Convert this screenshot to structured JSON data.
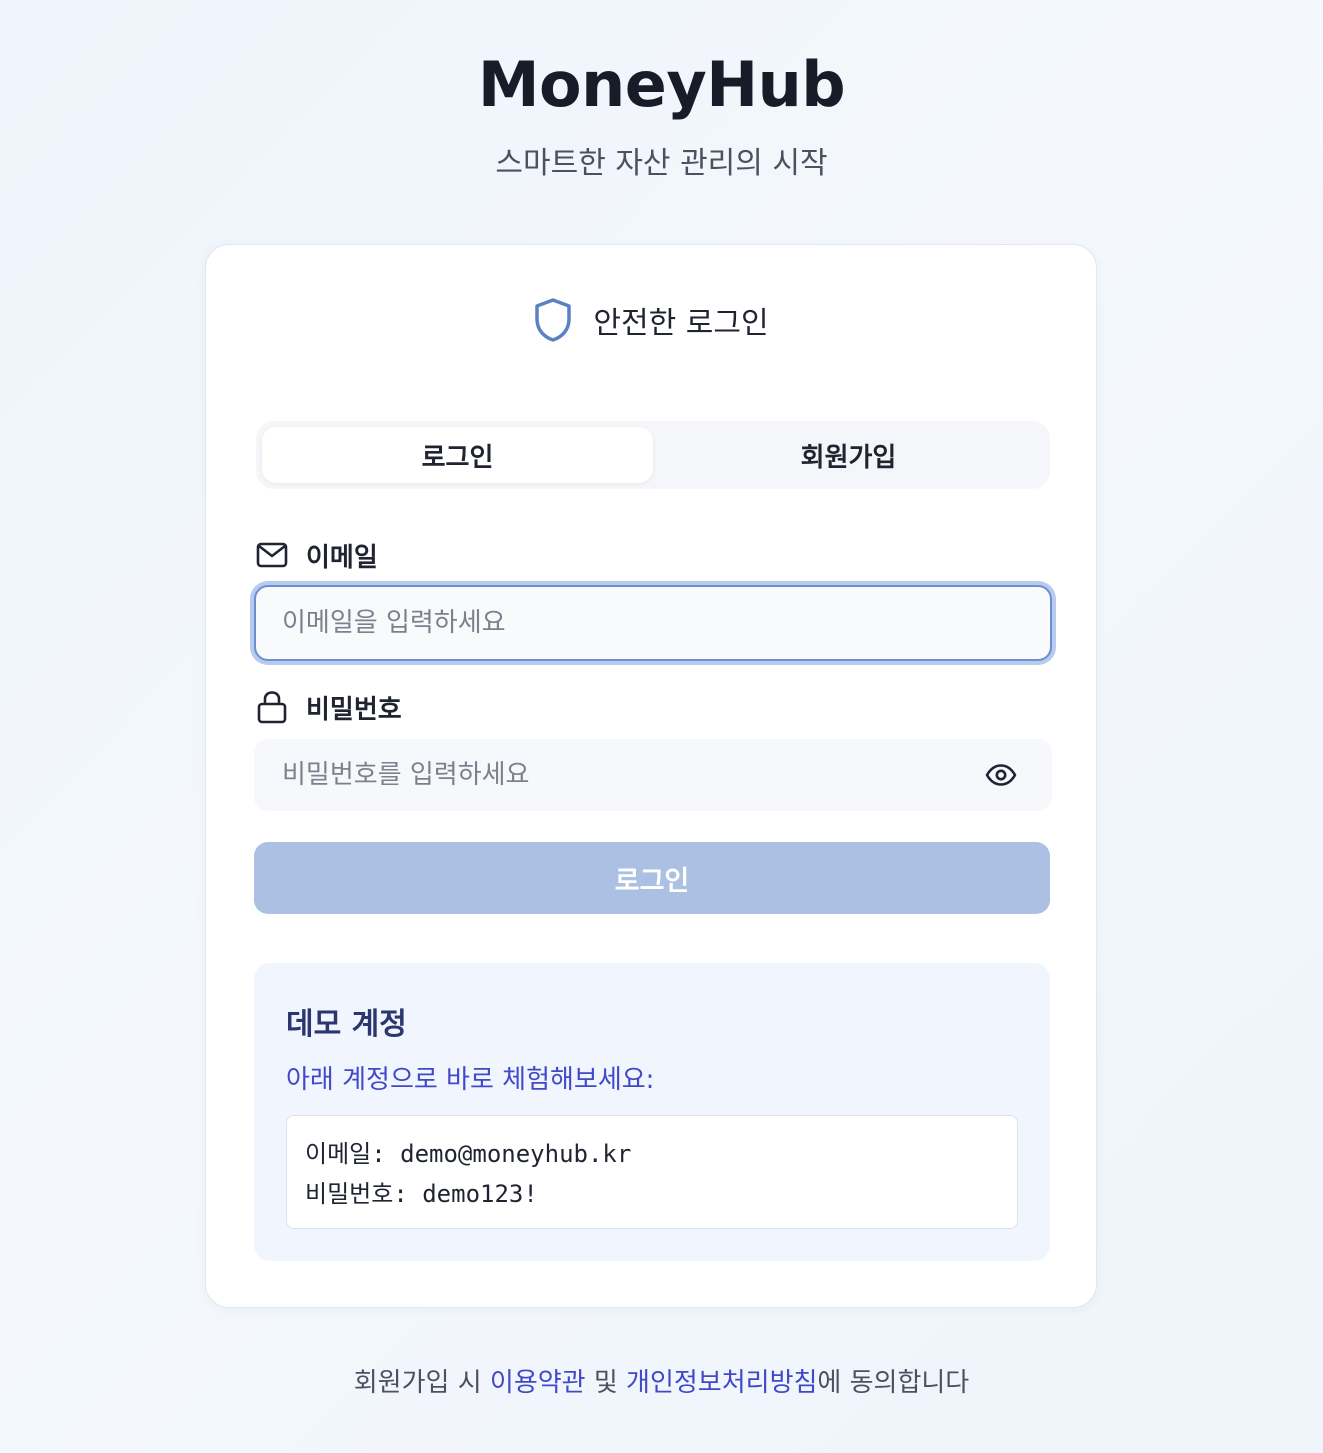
{
  "brand": {
    "title": "MoneyHub",
    "subtitle": "스마트한 자산 관리의 시작"
  },
  "card": {
    "title": "안전한 로그인",
    "header_icon": "shield-icon"
  },
  "tabs": [
    {
      "label": "로그인",
      "active": true
    },
    {
      "label": "회원가입",
      "active": false
    }
  ],
  "email": {
    "label": "이메일",
    "icon": "mail-icon",
    "placeholder": "이메일을 입력하세요",
    "value": ""
  },
  "password": {
    "label": "비밀번호",
    "icon": "lock-icon",
    "placeholder": "비밀번호를 입력하세요",
    "value": "",
    "toggle_icon": "eye-icon"
  },
  "submit": {
    "label": "로그인",
    "color": "#abc0e2"
  },
  "demo": {
    "title": "데모 계정",
    "description": "아래 계정으로 바로 체험해보세요:",
    "email_line": "이메일: demo@moneyhub.kr",
    "password_line": "비밀번호: demo123!"
  },
  "footer": {
    "prefix": "회원가입 시 ",
    "terms_link": "이용약관",
    "middle": " 및 ",
    "privacy_link": "개인정보처리방침",
    "suffix": "에 동의합니다"
  },
  "colors": {
    "accent": "#6d8fcf",
    "link": "#3f49c9",
    "demo_title": "#2a3670"
  }
}
